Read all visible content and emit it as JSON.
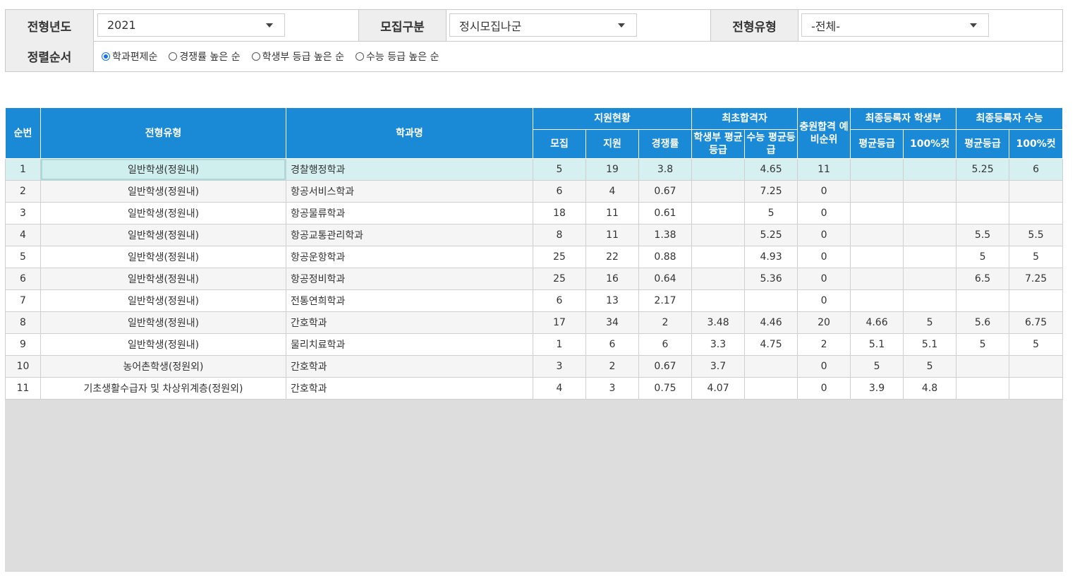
{
  "filters": {
    "year": {
      "label": "전형년도",
      "value": "2021"
    },
    "recruit": {
      "label": "모집구분",
      "value": "정시모집나군"
    },
    "type": {
      "label": "전형유형",
      "value": "-전체-"
    },
    "sort": {
      "label": "정렬순서",
      "options": [
        "학과편제순",
        "경쟁률 높은 순",
        "학생부 등급 높은 순",
        "수능 등급 높은 순"
      ],
      "selected": 0
    }
  },
  "table": {
    "headers": {
      "no": "순번",
      "type": "전형유형",
      "dept": "학과명",
      "apply_group": "지원현황",
      "recruit": "모집",
      "applicants": "지원",
      "ratio": "경쟁률",
      "first_group": "최초합격자",
      "first_school": "학생부 평균등급",
      "first_suneung": "수능 평균등급",
      "wait": "충원합격 예비순위",
      "final_school_group": "최종등록자 학생부",
      "final_school_avg": "평균등급",
      "final_school_cut": "100%컷",
      "final_suneung_group": "최종등록자 수능",
      "final_suneung_avg": "평균등급",
      "final_suneung_cut": "100%컷"
    },
    "rows": [
      {
        "no": "1",
        "type": "일반학생(정원내)",
        "dept": "경찰행정학과",
        "recruit": "5",
        "applicants": "19",
        "ratio": "3.8",
        "first_school": "",
        "first_suneung": "4.65",
        "wait": "11",
        "fs_avg": "",
        "fs_cut": "",
        "fn_avg": "5.25",
        "fn_cut": "6"
      },
      {
        "no": "2",
        "type": "일반학생(정원내)",
        "dept": "항공서비스학과",
        "recruit": "6",
        "applicants": "4",
        "ratio": "0.67",
        "first_school": "",
        "first_suneung": "7.25",
        "wait": "0",
        "fs_avg": "",
        "fs_cut": "",
        "fn_avg": "",
        "fn_cut": ""
      },
      {
        "no": "3",
        "type": "일반학생(정원내)",
        "dept": "항공물류학과",
        "recruit": "18",
        "applicants": "11",
        "ratio": "0.61",
        "first_school": "",
        "first_suneung": "5",
        "wait": "0",
        "fs_avg": "",
        "fs_cut": "",
        "fn_avg": "",
        "fn_cut": ""
      },
      {
        "no": "4",
        "type": "일반학생(정원내)",
        "dept": "항공교통관리학과",
        "recruit": "8",
        "applicants": "11",
        "ratio": "1.38",
        "first_school": "",
        "first_suneung": "5.25",
        "wait": "0",
        "fs_avg": "",
        "fs_cut": "",
        "fn_avg": "5.5",
        "fn_cut": "5.5"
      },
      {
        "no": "5",
        "type": "일반학생(정원내)",
        "dept": "항공운항학과",
        "recruit": "25",
        "applicants": "22",
        "ratio": "0.88",
        "first_school": "",
        "first_suneung": "4.93",
        "wait": "0",
        "fs_avg": "",
        "fs_cut": "",
        "fn_avg": "5",
        "fn_cut": "5"
      },
      {
        "no": "6",
        "type": "일반학생(정원내)",
        "dept": "항공정비학과",
        "recruit": "25",
        "applicants": "16",
        "ratio": "0.64",
        "first_school": "",
        "first_suneung": "5.36",
        "wait": "0",
        "fs_avg": "",
        "fs_cut": "",
        "fn_avg": "6.5",
        "fn_cut": "7.25"
      },
      {
        "no": "7",
        "type": "일반학생(정원내)",
        "dept": "전통연희학과",
        "recruit": "6",
        "applicants": "13",
        "ratio": "2.17",
        "first_school": "",
        "first_suneung": "",
        "wait": "0",
        "fs_avg": "",
        "fs_cut": "",
        "fn_avg": "",
        "fn_cut": ""
      },
      {
        "no": "8",
        "type": "일반학생(정원내)",
        "dept": "간호학과",
        "recruit": "17",
        "applicants": "34",
        "ratio": "2",
        "first_school": "3.48",
        "first_suneung": "4.46",
        "wait": "20",
        "fs_avg": "4.66",
        "fs_cut": "5",
        "fn_avg": "5.6",
        "fn_cut": "6.75"
      },
      {
        "no": "9",
        "type": "일반학생(정원내)",
        "dept": "물리치료학과",
        "recruit": "1",
        "applicants": "6",
        "ratio": "6",
        "first_school": "3.3",
        "first_suneung": "4.75",
        "wait": "2",
        "fs_avg": "5.1",
        "fs_cut": "5.1",
        "fn_avg": "5",
        "fn_cut": "5"
      },
      {
        "no": "10",
        "type": "농어촌학생(정원외)",
        "dept": "간호학과",
        "recruit": "3",
        "applicants": "2",
        "ratio": "0.67",
        "first_school": "3.7",
        "first_suneung": "",
        "wait": "0",
        "fs_avg": "5",
        "fs_cut": "5",
        "fn_avg": "",
        "fn_cut": ""
      },
      {
        "no": "11",
        "type": "기초생활수급자 및 차상위계층(정원외)",
        "dept": "간호학과",
        "recruit": "4",
        "applicants": "3",
        "ratio": "0.75",
        "first_school": "4.07",
        "first_suneung": "",
        "wait": "0",
        "fs_avg": "3.9",
        "fs_cut": "4.8",
        "fn_avg": "",
        "fn_cut": ""
      }
    ],
    "selected_row": 0
  },
  "colors": {
    "header_bg": "#1a8ad6",
    "selected_row": "#d6f0f2",
    "empty_area": "#dddddd"
  }
}
